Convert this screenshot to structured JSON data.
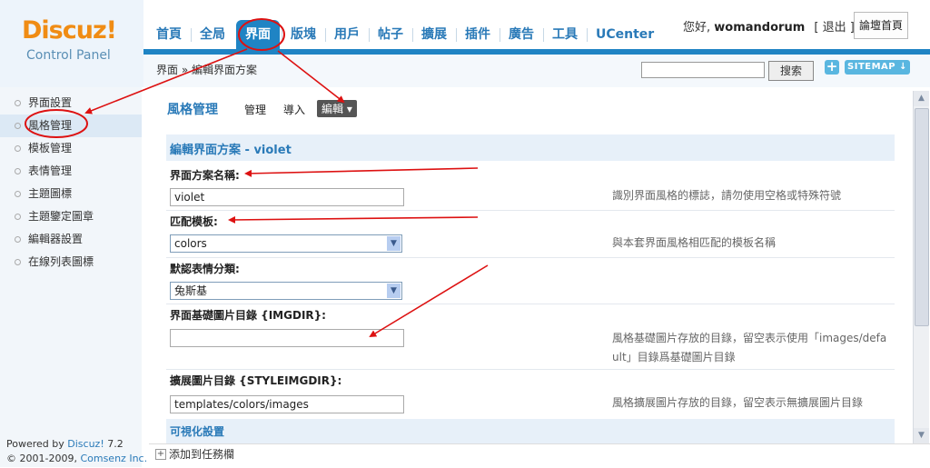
{
  "logo": {
    "word": "Discuz!",
    "sub": "Control Panel"
  },
  "nav": {
    "tabs": [
      "首頁",
      "全局",
      "界面",
      "版塊",
      "用戶",
      "帖子",
      "擴展",
      "插件",
      "廣告",
      "工具",
      "UCenter"
    ],
    "active": "界面"
  },
  "user": {
    "greeting": "您好,",
    "name": "womandorum",
    "logout": "[ 退出 ]",
    "home_button": "論壇首頁"
  },
  "breadcrumb": "界面 » 編輯界面方案",
  "search": {
    "value": "",
    "button": "搜索"
  },
  "toolbar": {
    "add_icon": "+",
    "sitemap": "SITEMAP ↓"
  },
  "sidebar": {
    "items": [
      "界面設置",
      "風格管理",
      "模板管理",
      "表情管理",
      "主題圖標",
      "主題鑒定圖章",
      "編輯器設置",
      "在線列表圖標"
    ],
    "active": "風格管理"
  },
  "powered": {
    "line1_prefix": "Powered by ",
    "line1_brand": "Discuz!",
    "line1_version": " 7.2",
    "line2_prefix": "© 2001-2009, ",
    "line2_company": "Comsenz Inc."
  },
  "page": {
    "title": "風格管理",
    "tabs": {
      "manage": "管理",
      "import": "導入",
      "edit": "編輯 ▾"
    },
    "section_title": "編輯界面方案 - violet",
    "fields": [
      {
        "label": "界面方案名稱:",
        "type": "text",
        "value": "violet",
        "hint": "識別界面風格的標誌，請勿使用空格或特殊符號"
      },
      {
        "label": "匹配模板:",
        "type": "select",
        "value": "colors",
        "hint": "與本套界面風格相匹配的模板名稱"
      },
      {
        "label": "默認表情分類:",
        "type": "select",
        "value": "兔斯基",
        "hint": ""
      },
      {
        "label": "界面基礎圖片目錄 {IMGDIR}:",
        "type": "text",
        "value": "",
        "hint_line1": "風格基礎圖片存放的目錄，留空表示使用「images/defa",
        "hint_line2": "ult」目錄爲基礎圖片目錄"
      },
      {
        "label": "擴展圖片目錄 {STYLEIMGDIR}:",
        "type": "text",
        "value": "templates/colors/images",
        "hint": "風格擴展圖片存放的目錄，留空表示無擴展圖片目錄"
      }
    ],
    "visual_section": "可視化設置"
  },
  "taskbar": {
    "label": "添加到任務欄"
  },
  "colors": {
    "accent": "#1f84c4",
    "link": "#2a7ab8",
    "logo": "#f08c14",
    "annotation": "#dd1111"
  }
}
